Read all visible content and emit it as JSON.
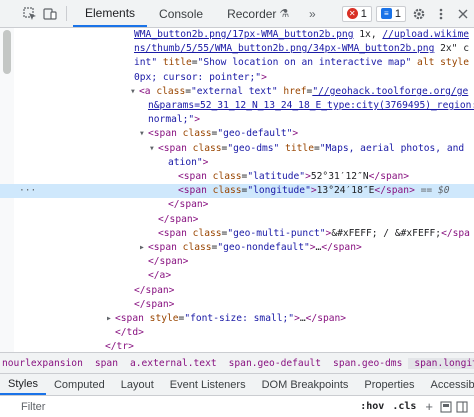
{
  "toolbar": {
    "tabs": [
      "Elements",
      "Console",
      "Recorder"
    ],
    "errors_count": "1",
    "messages_count": "1"
  },
  "tree": {
    "lines": [
      {
        "indent": 134,
        "parts": [
          [
            "link",
            "WMA_button2b.png/17px-WMA_button2b.png"
          ],
          [
            "txt",
            " 1x, "
          ],
          [
            "link",
            "//upload.wikime"
          ]
        ]
      },
      {
        "indent": 134,
        "parts": [
          [
            "link",
            "ns/thumb/5/55/WMA_button2b.png/34px-WMA_button2b.png"
          ],
          [
            "txt",
            " 2x\" c"
          ]
        ]
      },
      {
        "indent": 134,
        "parts": [
          [
            "val",
            "int\""
          ],
          [
            "attr",
            " title"
          ],
          [
            "txt",
            "="
          ],
          [
            "val",
            "\"Show location on an interactive map\""
          ],
          [
            "attr",
            " alt style"
          ]
        ]
      },
      {
        "indent": 134,
        "parts": [
          [
            "val",
            "0px; cursor: pointer;\""
          ],
          [
            "tag",
            ">"
          ]
        ]
      },
      {
        "indent": 139,
        "arrow": "▾",
        "parts": [
          [
            "tag",
            "<a"
          ],
          [
            "attr",
            " class"
          ],
          [
            "txt",
            "="
          ],
          [
            "val",
            "\"external text\""
          ],
          [
            "attr",
            " href"
          ],
          [
            "txt",
            "="
          ],
          [
            "link",
            "\"//geohack.toolforge.org/ge"
          ]
        ]
      },
      {
        "indent": 148,
        "parts": [
          [
            "link",
            "n&params=52_31_12_N_13_24_18_E_type:city(3769495)_region:DE"
          ]
        ]
      },
      {
        "indent": 148,
        "parts": [
          [
            "val",
            "normal;\""
          ],
          [
            "tag",
            ">"
          ]
        ]
      },
      {
        "indent": 148,
        "arrow": "▾",
        "parts": [
          [
            "tag",
            "<span"
          ],
          [
            "attr",
            " class"
          ],
          [
            "txt",
            "="
          ],
          [
            "val",
            "\"geo-default\""
          ],
          [
            "tag",
            ">"
          ]
        ]
      },
      {
        "indent": 158,
        "arrow": "▾",
        "parts": [
          [
            "tag",
            "<span"
          ],
          [
            "attr",
            " class"
          ],
          [
            "txt",
            "="
          ],
          [
            "val",
            "\"geo-dms\""
          ],
          [
            "attr",
            " title"
          ],
          [
            "txt",
            "="
          ],
          [
            "val",
            "\"Maps, aerial photos, and"
          ]
        ]
      },
      {
        "indent": 168,
        "parts": [
          [
            "val",
            "ation\""
          ],
          [
            "tag",
            ">"
          ]
        ]
      },
      {
        "indent": 178,
        "parts": [
          [
            "tag",
            "<span"
          ],
          [
            "attr",
            " class"
          ],
          [
            "txt",
            "="
          ],
          [
            "val",
            "\"latitude\""
          ],
          [
            "tag",
            ">"
          ],
          [
            "txt",
            "52°31′12″N"
          ],
          [
            "tag",
            "</span>"
          ]
        ]
      },
      {
        "indent": 178,
        "hl": true,
        "dots": true,
        "parts": [
          [
            "tag",
            "<span"
          ],
          [
            "attr",
            " class"
          ],
          [
            "txt",
            "="
          ],
          [
            "val",
            "\"longitude\""
          ],
          [
            "tag",
            ">"
          ],
          [
            "txt",
            "13°24′18″E"
          ],
          [
            "tag",
            "</span>"
          ],
          [
            "eq",
            " == $0"
          ]
        ]
      },
      {
        "indent": 168,
        "parts": [
          [
            "tag",
            "</span>"
          ]
        ]
      },
      {
        "indent": 158,
        "parts": [
          [
            "tag",
            "</span>"
          ]
        ]
      },
      {
        "indent": 158,
        "parts": [
          [
            "tag",
            "<span"
          ],
          [
            "attr",
            " class"
          ],
          [
            "txt",
            "="
          ],
          [
            "val",
            "\"geo-multi-punct\""
          ],
          [
            "tag",
            ">"
          ],
          [
            "txt",
            "&#xFEFF; / &#xFEFF;"
          ],
          [
            "tag",
            "</spa"
          ]
        ]
      },
      {
        "indent": 148,
        "arrow": "▸",
        "parts": [
          [
            "tag",
            "<span"
          ],
          [
            "attr",
            " class"
          ],
          [
            "txt",
            "="
          ],
          [
            "val",
            "\"geo-nondefault\""
          ],
          [
            "tag",
            ">"
          ],
          [
            "txt",
            "…"
          ],
          [
            "tag",
            "</span>"
          ]
        ]
      },
      {
        "indent": 148,
        "parts": [
          [
            "tag",
            "</span>"
          ]
        ]
      },
      {
        "indent": 148,
        "parts": [
          [
            "tag",
            "</a>"
          ]
        ]
      },
      {
        "indent": 134,
        "parts": [
          [
            "tag",
            "</span>"
          ]
        ]
      },
      {
        "indent": 134,
        "parts": [
          [
            "tag",
            "</span>"
          ]
        ]
      },
      {
        "indent": 115,
        "arrow": "▸",
        "parts": [
          [
            "tag",
            "<span"
          ],
          [
            "attr",
            " style"
          ],
          [
            "txt",
            "="
          ],
          [
            "val",
            "\"font-size: small;\""
          ],
          [
            "tag",
            ">"
          ],
          [
            "txt",
            "…"
          ],
          [
            "tag",
            "</span>"
          ]
        ]
      },
      {
        "indent": 115,
        "parts": [
          [
            "tag",
            "</td>"
          ]
        ]
      },
      {
        "indent": 105,
        "parts": [
          [
            "tag",
            "</tr>"
          ]
        ]
      }
    ]
  },
  "breadcrumb": [
    "nourlexpansion",
    "span",
    "a.external.text",
    "span.geo-default",
    "span.geo-dms",
    "span.longitude"
  ],
  "bottom_tabs": [
    "Styles",
    "Computed",
    "Layout",
    "Event Listeners",
    "DOM Breakpoints",
    "Properties",
    "Accessibility"
  ],
  "filter": {
    "placeholder": "Filter",
    "hov": ":hov",
    "cls": ".cls",
    "plus": "+"
  }
}
